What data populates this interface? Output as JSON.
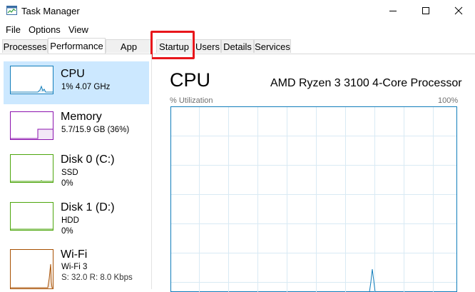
{
  "window": {
    "title": "Task Manager"
  },
  "menu": [
    "File",
    "Options",
    "View"
  ],
  "tabs": [
    {
      "label": "Processes"
    },
    {
      "label": "Performance"
    },
    {
      "label": "App history"
    },
    {
      "label": "Startup"
    },
    {
      "label": "Users"
    },
    {
      "label": "Details"
    },
    {
      "label": "Services"
    }
  ],
  "active_tab": "Performance",
  "highlighted_tab": "Startup",
  "sidebar": [
    {
      "name": "CPU",
      "sub1": "1% 4.07 GHz",
      "color": "#117dbb"
    },
    {
      "name": "Memory",
      "sub1": "5.7/15.9 GB (36%)",
      "color": "#8b12ae"
    },
    {
      "name": "Disk 0 (C:)",
      "sub1": "SSD",
      "sub2": "0%",
      "color": "#4da60c"
    },
    {
      "name": "Disk 1 (D:)",
      "sub1": "HDD",
      "sub2": "0%",
      "color": "#4da60c"
    },
    {
      "name": "Wi-Fi",
      "sub1": "Wi-Fi 3",
      "sub2": "S: 32.0  R: 8.0 Kbps",
      "color": "#a74f01"
    }
  ],
  "main": {
    "title": "CPU",
    "processor": "AMD Ryzen 3 3100 4-Core Processor",
    "util_label": "% Utilization",
    "util_max": "100%"
  },
  "colors": {
    "selected_bg": "#cce8ff",
    "highlight": "#e8161b",
    "cpu_grid": "#d9eaf4",
    "cpu_line": "#117dbb"
  }
}
